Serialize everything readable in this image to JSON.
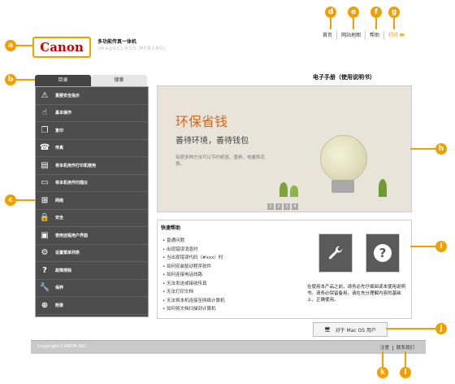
{
  "header": {
    "logo": "Canon",
    "product_name": "多功能传真一体机",
    "product_model": "imageCLASS MF8180c",
    "links": [
      "首页",
      "网站地图",
      "帮助",
      "打印"
    ],
    "manual_title": "电子手册（使用说明书）"
  },
  "tabs": [
    "目录",
    "搜索"
  ],
  "sidebar": {
    "items": [
      {
        "label": "重要安全指示",
        "icon": "warning-icon"
      },
      {
        "label": "基本操作",
        "icon": "hand-icon"
      },
      {
        "label": "复印",
        "icon": "copy-icon"
      },
      {
        "label": "传真",
        "icon": "fax-icon"
      },
      {
        "label": "将本机用作打印机使用",
        "icon": "printer-icon"
      },
      {
        "label": "将本机用作扫描仪",
        "icon": "scanner-icon"
      },
      {
        "label": "网络",
        "icon": "network-icon"
      },
      {
        "label": "安全",
        "icon": "lock-icon"
      },
      {
        "label": "使用远程用户界面",
        "icon": "remote-ui-icon"
      },
      {
        "label": "设置菜单列表",
        "icon": "menu-list-icon"
      },
      {
        "label": "故障排除",
        "icon": "question-icon"
      },
      {
        "label": "保养",
        "icon": "wrench-icon"
      },
      {
        "label": "附录",
        "icon": "plus-icon"
      }
    ]
  },
  "banner": {
    "title": "环保省钱",
    "subtitle": "善待环境，善待钱包",
    "description": "有很多种方法可以节约纸张、墨粉、电量和花费。",
    "pages": [
      "1",
      "2",
      "3",
      "4"
    ]
  },
  "quick_help": {
    "title": "快速帮助",
    "items": [
      "普通问题",
      "出现错误消息时",
      "当出现错误代码（#xxx）时",
      "如何安装驱动程序软件",
      "如何连接电话线路",
      "无法发送或接收传真",
      "无法打印文档",
      "无法将本机连接至网络计算机",
      "如何将文档扫描到计算机"
    ]
  },
  "note": "在使用本产品之前，请务必先仔细阅读本使用说明书。请务必保留备用。请在充分理解内容的基础上，正确使用。",
  "mac_button": "对于 Mac OS 用户",
  "footer": {
    "copyright": "Copyright CANON INC.",
    "links": [
      "注意",
      "联系我们"
    ]
  },
  "callouts": [
    "a",
    "b",
    "c",
    "d",
    "e",
    "f",
    "g",
    "h",
    "i",
    "j",
    "k",
    "l"
  ],
  "colors": {
    "accent": "#f0a000",
    "brand": "#cc0000",
    "sidebar_bg": "#4d4d4d"
  }
}
